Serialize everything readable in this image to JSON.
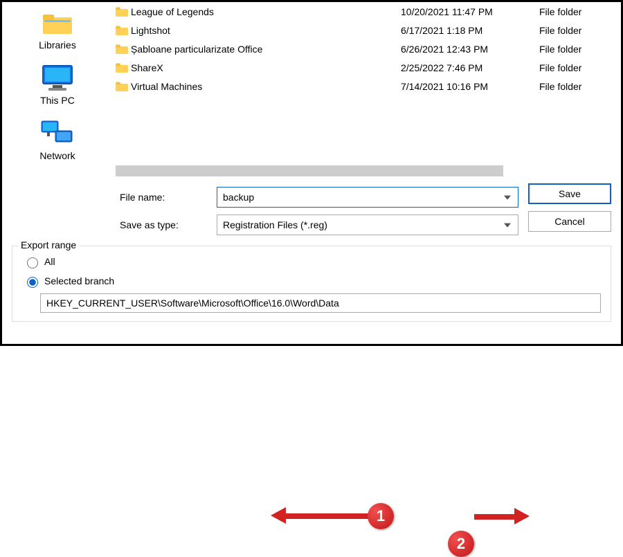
{
  "sidebar": {
    "items": [
      {
        "label": "Libraries"
      },
      {
        "label": "This PC"
      },
      {
        "label": "Network"
      }
    ]
  },
  "files": [
    {
      "name": "League of Legends",
      "date": "10/20/2021 11:47 PM",
      "type": "File folder"
    },
    {
      "name": "Lightshot",
      "date": "6/17/2021 1:18 PM",
      "type": "File folder"
    },
    {
      "name": "Șabloane particularizate Office",
      "date": "6/26/2021 12:43 PM",
      "type": "File folder"
    },
    {
      "name": "ShareX",
      "date": "2/25/2022 7:46 PM",
      "type": "File folder"
    },
    {
      "name": "Virtual Machines",
      "date": "7/14/2021 10:16 PM",
      "type": "File folder"
    }
  ],
  "form": {
    "filename_label": "File name:",
    "filename_value": "backup",
    "savetype_label": "Save as type:",
    "savetype_value": "Registration Files (*.reg)",
    "save_label": "Save",
    "cancel_label": "Cancel"
  },
  "export": {
    "legend": "Export range",
    "all_label": "All",
    "selected_label": "Selected branch",
    "branch_value": "HKEY_CURRENT_USER\\Software\\Microsoft\\Office\\16.0\\Word\\Data"
  },
  "annotations": {
    "badge1": "1",
    "badge2": "2"
  }
}
